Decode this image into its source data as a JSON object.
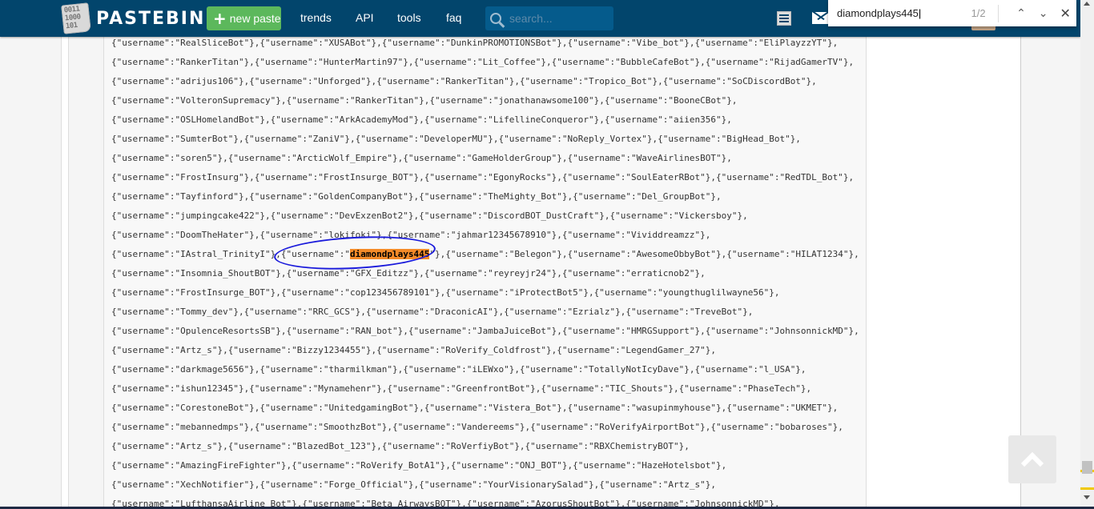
{
  "header": {
    "logo_text": "PASTEBIN",
    "logo_digits": [
      "0011",
      "1000",
      "101"
    ],
    "new_paste_label": "new paste",
    "nav": [
      "trends",
      "API",
      "tools",
      "faq"
    ],
    "search_placeholder": "search..."
  },
  "find_bar": {
    "query": "diamondplays445",
    "match_count": "1/2",
    "prev_icon": "chevron-up-icon",
    "next_icon": "chevron-down-icon",
    "close_icon": "close-icon"
  },
  "paste_lines": [
    "{\"username\":\"RealSliceBot\"},{\"username\":\"XUSABot\"},{\"username\":\"DunkinPROMOTIONSBot\"},{\"username\":\"Vibe_bot\"},{\"username\":\"EliPlayzzYT\"},",
    "{\"username\":\"RankerTitan\"},{\"username\":\"HunterMartin97\"},{\"username\":\"Lit_Coffee\"},{\"username\":\"BubbleCafeBot\"},{\"username\":\"RijadGamerTV\"},",
    "{\"username\":\"adrijus106\"},{\"username\":\"Unforged\"},{\"username\":\"RankerTitan\"},{\"username\":\"Tropico_Bot\"},{\"username\":\"SoCDiscordBot\"},",
    "{\"username\":\"VolteronSupremacy\"},{\"username\":\"RankerTitan\"},{\"username\":\"jonathanawsome100\"},{\"username\":\"BooneCBot\"},",
    "{\"username\":\"OSLHomelandBot\"},{\"username\":\"ArkAcademyMod\"},{\"username\":\"LifellineConqueror\"},{\"username\":\"aiien356\"},",
    "{\"username\":\"SumterBot\"},{\"username\":\"ZaniV\"},{\"username\":\"DeveloperMU\"},{\"username\":\"NoReply_Vortex\"},{\"username\":\"BigHead_Bot\"},",
    "{\"username\":\"soren5\"},{\"username\":\"ArcticWolf_Empire\"},{\"username\":\"GameHolderGroup\"},{\"username\":\"WaveAirlinesBOT\"},",
    "{\"username\":\"FrostInsurg\"},{\"username\":\"FrostInsurge_BOT\"},{\"username\":\"EgonyRocks\"},{\"username\":\"SoulEaterRBot\"},{\"username\":\"RedTDL_Bot\"},",
    "{\"username\":\"Tayfinford\"},{\"username\":\"GoldenCompanyBot\"},{\"username\":\"TheMighty_Bot\"},{\"username\":\"Del_GroupBot\"},",
    "{\"username\":\"jumpingcake422\"},{\"username\":\"DevExzenBot2\"},{\"username\":\"DiscordBOT_DustCraft\"},{\"username\":\"Vickersboy\"},",
    "{\"username\":\"DoomTheHater\"},{\"username\":\"lokifoki\"},{\"username\":\"jahmar12345678910\"},{\"username\":\"Vividdreamzz\"},",
    "{\"username\":\"IAstral_TrinityI\"},{\"username\":\"diamondplays445\"},{\"username\":\"Belegon\"},{\"username\":\"AwesomeObbyBot\"},{\"username\":\"HILAT1234\"},",
    "{\"username\":\"Insomnia_ShoutBOT\"},{\"username\":\"GFX_Editzz\"},{\"username\":\"reyreyjr24\"},{\"username\":\"erraticnob2\"},",
    "{\"username\":\"FrostInsurge_BOT\"},{\"username\":\"cop123456789101\"},{\"username\":\"iProtectBot5\"},{\"username\":\"youngthuglilwayne56\"},",
    "{\"username\":\"Tommy_dev\"},{\"username\":\"RRC_GCS\"},{\"username\":\"DraconicAI\"},{\"username\":\"Ezrialz\"},{\"username\":\"TreveBot\"},",
    "{\"username\":\"OpulenceResortsSB\"},{\"username\":\"RAN_bot\"},{\"username\":\"JambaJuiceBot\"},{\"username\":\"HMRGSupport\"},{\"username\":\"JohnsonnickMD\"},",
    "{\"username\":\"Artz_s\"},{\"username\":\"Bizzy1234455\"},{\"username\":\"RoVerify_Coldfrost\"},{\"username\":\"LegendGamer_27\"},",
    "{\"username\":\"darkmage5656\"},{\"username\":\"tharmilkman\"},{\"username\":\"iLEWxo\"},{\"username\":\"TotallyNotIcyDave\"},{\"username\":\"l_USA\"},",
    "{\"username\":\"ishun12345\"},{\"username\":\"Mynamehenr\"},{\"username\":\"GreenfrontBot\"},{\"username\":\"TIC_Shouts\"},{\"username\":\"PhaseTech\"},",
    "{\"username\":\"CorestoneBot\"},{\"username\":\"UnitedgamingBot\"},{\"username\":\"Vistera_Bot\"},{\"username\":\"wasupinmyhouse\"},{\"username\":\"UKMET\"},",
    "{\"username\":\"mebannedmps\"},{\"username\":\"SmoothzBot\"},{\"username\":\"Vandereems\"},{\"username\":\"RoVerifyAirportBot\"},{\"username\":\"bobaroses\"},",
    "{\"username\":\"Artz_s\"},{\"username\":\"BlazedBot_123\"},{\"username\":\"RoVerfiyBot\"},{\"username\":\"RBXChemistryBOT\"},",
    "{\"username\":\"AmazingFireFighter\"},{\"username\":\"RoVerify_BotA1\"},{\"username\":\"ONJ_BOT\"},{\"username\":\"HazeHotelsbot\"},",
    "{\"username\":\"XechNotifier\"},{\"username\":\"Forge_Official\"},{\"username\":\"YourVisionarySalad\"},{\"username\":\"Artz_s\"},",
    "{\"username\":\"LufthansaAirline_Bot\"},{\"username\":\"Beta_AirwaysBOT\"},{\"username\":\"AzorusShoutBot\"},{\"username\":\"JohnsonnickMD\"},"
  ],
  "highlight": {
    "term": "diamondplays445",
    "color": "#f48b29"
  },
  "colors": {
    "header_bg": "#02456c",
    "new_paste_bg": "#5cb85c",
    "annotation": "#1a1adb"
  }
}
